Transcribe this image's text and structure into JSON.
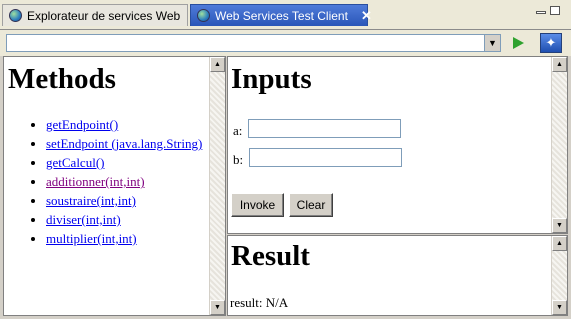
{
  "tabs": [
    {
      "label": "Explorateur de services Web",
      "active": false
    },
    {
      "label": "Web Services Test Client",
      "active": true,
      "close": "✕"
    }
  ],
  "toolbar": {
    "address_value": "",
    "combo_arrow": "▼",
    "go_icon": "play-triangle-icon",
    "nav_icon_glyph": "✦"
  },
  "methods": {
    "title": "Methods",
    "items": [
      {
        "label": "getEndpoint()",
        "visited": false
      },
      {
        "label": "setEndpoint (java.lang.String)",
        "visited": false
      },
      {
        "label": "getCalcul()",
        "visited": false
      },
      {
        "label": "additionner(int,int)",
        "visited": true
      },
      {
        "label": "soustraire(int,int)",
        "visited": false
      },
      {
        "label": "diviser(int,int)",
        "visited": false
      },
      {
        "label": "multiplier(int,int)",
        "visited": false
      }
    ]
  },
  "inputs": {
    "title": "Inputs",
    "fields": [
      {
        "label": "a:",
        "value": ""
      },
      {
        "label": "b:",
        "value": ""
      }
    ],
    "invoke_label": "Invoke",
    "clear_label": "Clear"
  },
  "result": {
    "title": "Result",
    "text": "result: N/A"
  },
  "scroll": {
    "up": "▲",
    "down": "▼"
  },
  "colors": {
    "link": "#0000ee",
    "visited_link": "#800080",
    "active_tab": "#2a56b8"
  }
}
